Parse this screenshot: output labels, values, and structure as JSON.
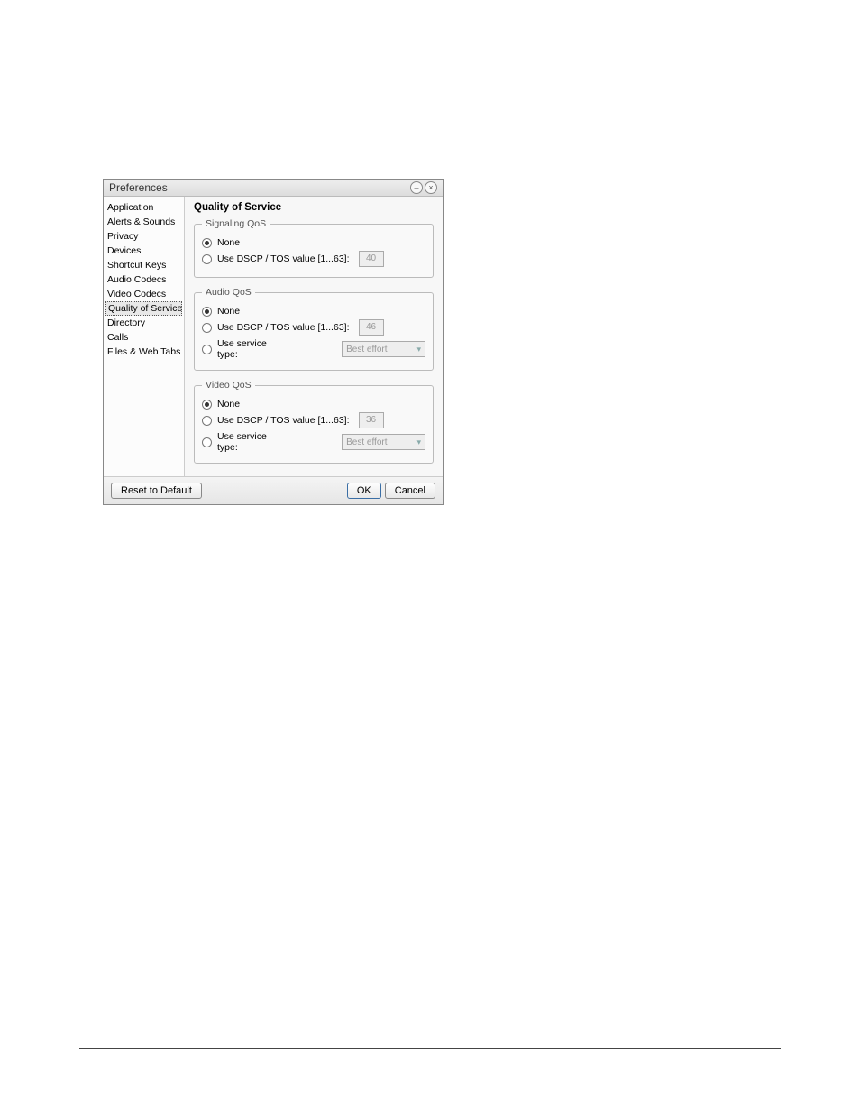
{
  "titlebar": {
    "title": "Preferences"
  },
  "sidebar": {
    "items": [
      {
        "label": "Application"
      },
      {
        "label": "Alerts & Sounds"
      },
      {
        "label": "Privacy"
      },
      {
        "label": "Devices"
      },
      {
        "label": "Shortcut Keys"
      },
      {
        "label": "Audio Codecs"
      },
      {
        "label": "Video Codecs"
      },
      {
        "label": "Quality of Service"
      },
      {
        "label": "Directory"
      },
      {
        "label": "Calls"
      },
      {
        "label": "Files & Web Tabs"
      }
    ],
    "selected_index": 7
  },
  "content": {
    "title": "Quality of Service",
    "groups": {
      "signaling": {
        "legend": "Signaling QoS",
        "none_label": "None",
        "dscp_label": "Use DSCP / TOS value [1...63]:",
        "dscp_value": "40"
      },
      "audio": {
        "legend": "Audio QoS",
        "none_label": "None",
        "dscp_label": "Use DSCP / TOS value [1...63]:",
        "dscp_value": "46",
        "service_label": "Use service type:",
        "service_value": "Best effort"
      },
      "video": {
        "legend": "Video QoS",
        "none_label": "None",
        "dscp_label": "Use DSCP / TOS value [1...63]:",
        "dscp_value": "36",
        "service_label": "Use service type:",
        "service_value": "Best effort"
      }
    }
  },
  "footer": {
    "reset": "Reset to Default",
    "ok": "OK",
    "cancel": "Cancel"
  }
}
